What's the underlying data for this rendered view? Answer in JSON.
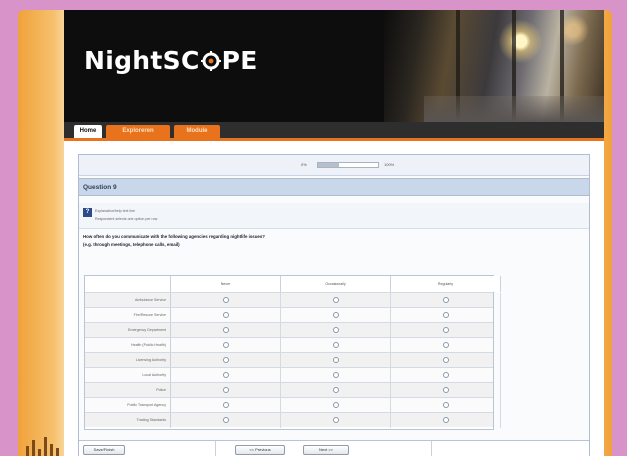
{
  "site": {
    "logo_part1": "NightSC",
    "logo_part2": "PE"
  },
  "nav": {
    "tabs": [
      {
        "label": "Home",
        "active": true
      },
      {
        "label": "Exploreren",
        "active": false
      },
      {
        "label": "Module",
        "active": false
      }
    ]
  },
  "survey": {
    "progress": {
      "left_label": "0%",
      "right_label": "100%",
      "fraction": 0.35
    },
    "question_title": "Question 9",
    "help_lines": [
      "Explanation/help text line",
      "Respondent selects one option per row"
    ],
    "question_lines": [
      "How often do you communicate with the following agencies regarding nightlife issues?",
      "(e.g. through meetings, telephone calls, email)"
    ],
    "columns": [
      "Never",
      "Occasionally",
      "Regularly"
    ],
    "rows": [
      "Ambulance Service",
      "Fire/Rescue Service",
      "Emergency Department",
      "Health (Public Health)",
      "Licensing Authority",
      "Local Authority",
      "Police",
      "Public Transport Agency",
      "Trading Standards"
    ],
    "footer": {
      "save_label": "Save/Finish",
      "previous_label": "<< Previous",
      "next_label": "Next >>"
    }
  },
  "colors": {
    "brand_orange": "#e8731c",
    "header_black": "#0d0d0d",
    "question_bar": "#c9d7ea",
    "page_background": "#d893c8"
  }
}
